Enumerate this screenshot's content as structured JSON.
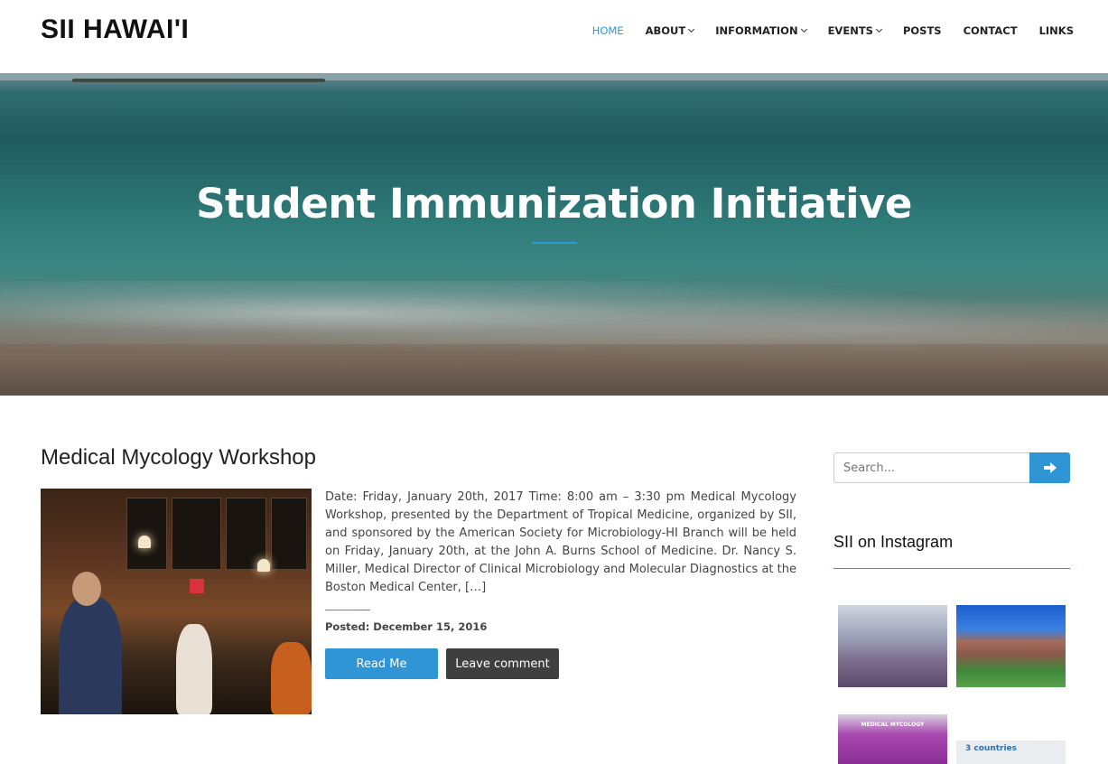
{
  "header": {
    "site_title": "SII HAWAI'I",
    "nav": [
      {
        "label": "HOME",
        "active": true,
        "has_dropdown": false
      },
      {
        "label": "ABOUT",
        "active": false,
        "has_dropdown": true
      },
      {
        "label": "INFORMATION",
        "active": false,
        "has_dropdown": true
      },
      {
        "label": "EVENTS",
        "active": false,
        "has_dropdown": true
      },
      {
        "label": "POSTS",
        "active": false,
        "has_dropdown": false
      },
      {
        "label": "CONTACT",
        "active": false,
        "has_dropdown": false
      },
      {
        "label": "LINKS",
        "active": false,
        "has_dropdown": false
      }
    ]
  },
  "hero": {
    "title": "Student Immunization Initiative"
  },
  "post": {
    "title": "Medical Mycology Workshop",
    "excerpt": "Date: Friday, January 20th, 2017 Time: 8:00 am – 3:30 pm Medical Mycology Workshop, presented by the Department of Tropical Medicine, organized by SII, and sponsored by the American Society for Microbiology-HI Branch will be held on Friday, January 20th, at the John A. Burns School of Medicine. Dr. Nancy S. Miller, Medical Director of Clinical Microbiology and Molecular Diagnostics at the Boston Medical Center, […]",
    "meta": "Posted: December 15, 2016",
    "read_label": "Read Me",
    "comment_label": "Leave comment"
  },
  "sidebar": {
    "search_placeholder": "Search...",
    "instagram_title": "SII on Instagram",
    "insta_3_text": "MEDICAL MYCOLOGY",
    "insta_4_text": "3 countries"
  },
  "colors": {
    "accent": "#2b9bd6",
    "button_primary": "#2f95d4",
    "button_dark": "#3f3f3f"
  }
}
